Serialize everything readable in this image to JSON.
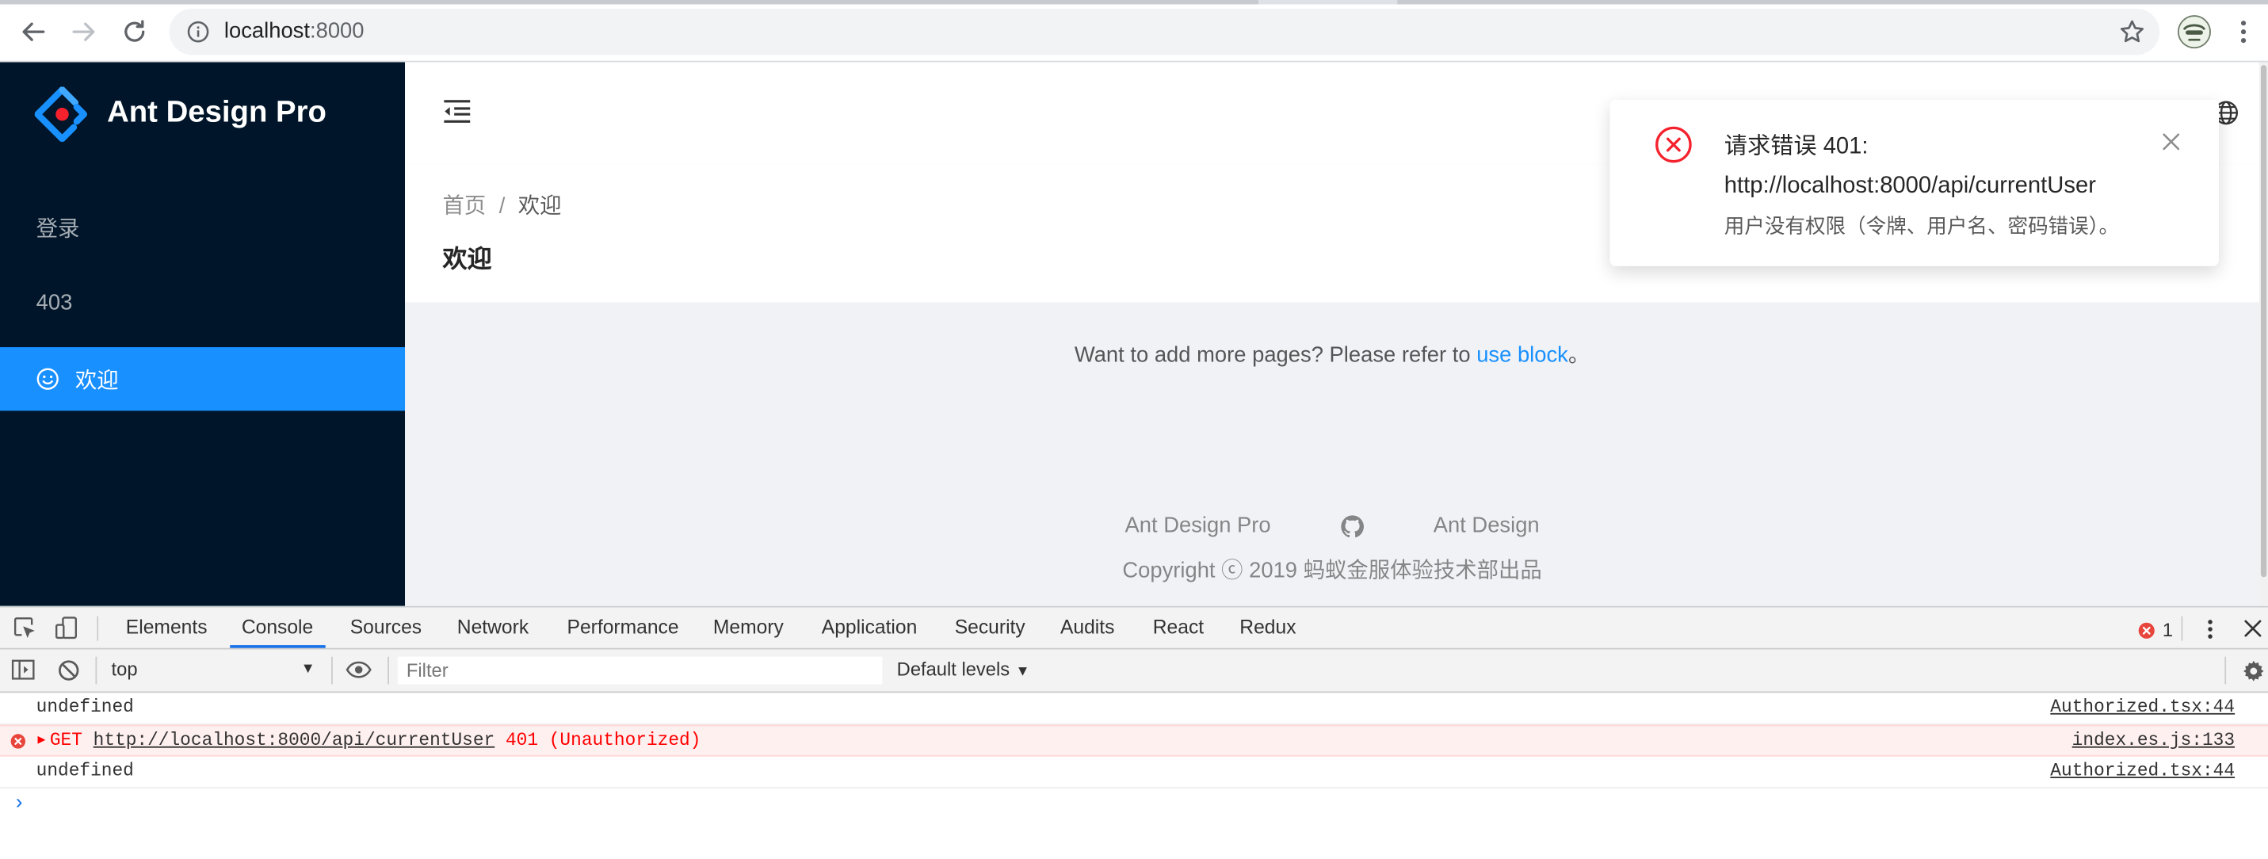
{
  "browser": {
    "url_host": "localhost",
    "url_port": ":8000"
  },
  "app": {
    "brand": "Ant Design Pro",
    "menu": [
      {
        "label": "登录"
      },
      {
        "label": "403"
      },
      {
        "label": "欢迎",
        "active": true
      }
    ],
    "breadcrumb": {
      "home": "首页",
      "separator": "/",
      "current": "欢迎"
    },
    "page_title": "欢迎",
    "welcome": {
      "text": "Want to add more pages? Please refer to ",
      "link": "use block",
      "suffix": "。"
    },
    "footer": {
      "link_pro": "Ant Design Pro",
      "link_antd": "Ant Design",
      "copyright": "Copyright ⓒ 2019 蚂蚁金服体验技术部出品"
    },
    "accent_color": "#1890ff",
    "sider_color": "#001529"
  },
  "notification": {
    "title_line1": "请求错误 401:",
    "title_line2": "http://localhost:8000/api/currentUser",
    "description": "用户没有权限（令牌、用户名、密码错误）。",
    "error_color": "#f5222d"
  },
  "devtools": {
    "tabs": [
      "Elements",
      "Console",
      "Sources",
      "Network",
      "Performance",
      "Memory",
      "Application",
      "Security",
      "Audits",
      "React",
      "Redux"
    ],
    "active_tab": "Console",
    "error_count": "1",
    "context": "top",
    "filter_placeholder": "Filter",
    "levels": "Default levels",
    "console_lines": [
      {
        "message": "undefined",
        "source": "Authorized.tsx:44"
      },
      {
        "method": "GET",
        "url": "http://localhost:8000/api/currentUser",
        "status": "401 (Unauthorized)",
        "source": "index.es.js:133"
      },
      {
        "message": "undefined",
        "source": "Authorized.tsx:44"
      }
    ],
    "prompt": "›"
  }
}
